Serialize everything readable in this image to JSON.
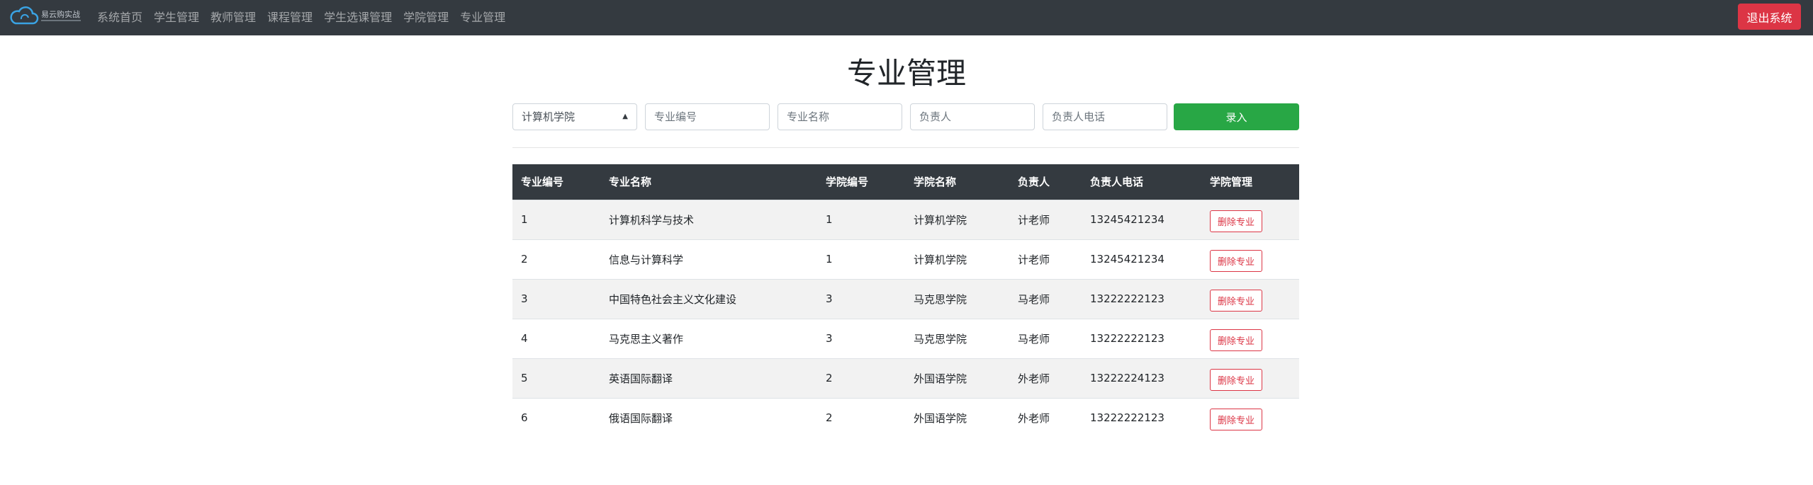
{
  "header": {
    "logo_text": "易云购实战",
    "nav": [
      "系统首页",
      "学生管理",
      "教师管理",
      "课程管理",
      "学生选课管理",
      "学院管理",
      "专业管理"
    ],
    "logout_label": "退出系统"
  },
  "page_title": "专业管理",
  "form": {
    "college_selected": "计算机学院",
    "major_code_placeholder": "专业编号",
    "major_name_placeholder": "专业名称",
    "manager_placeholder": "负责人",
    "manager_phone_placeholder": "负责人电话",
    "submit_label": "录入"
  },
  "table": {
    "headers": [
      "专业编号",
      "专业名称",
      "学院编号",
      "学院名称",
      "负责人",
      "负责人电话",
      "学院管理"
    ],
    "rows": [
      {
        "id": "1",
        "name": "计算机科学与技术",
        "college_id": "1",
        "college": "计算机学院",
        "manager": "计老师",
        "phone": "13245421234",
        "action": "删除专业"
      },
      {
        "id": "2",
        "name": "信息与计算科学",
        "college_id": "1",
        "college": "计算机学院",
        "manager": "计老师",
        "phone": "13245421234",
        "action": "删除专业"
      },
      {
        "id": "3",
        "name": "中国特色社会主义文化建设",
        "college_id": "3",
        "college": "马克思学院",
        "manager": "马老师",
        "phone": "13222222123",
        "action": "删除专业"
      },
      {
        "id": "4",
        "name": "马克思主义著作",
        "college_id": "3",
        "college": "马克思学院",
        "manager": "马老师",
        "phone": "13222222123",
        "action": "删除专业"
      },
      {
        "id": "5",
        "name": "英语国际翻译",
        "college_id": "2",
        "college": "外国语学院",
        "manager": "外老师",
        "phone": "13222224123",
        "action": "删除专业"
      },
      {
        "id": "6",
        "name": "俄语国际翻译",
        "college_id": "2",
        "college": "外国语学院",
        "manager": "外老师",
        "phone": "13222222123",
        "action": "删除专业"
      }
    ]
  }
}
